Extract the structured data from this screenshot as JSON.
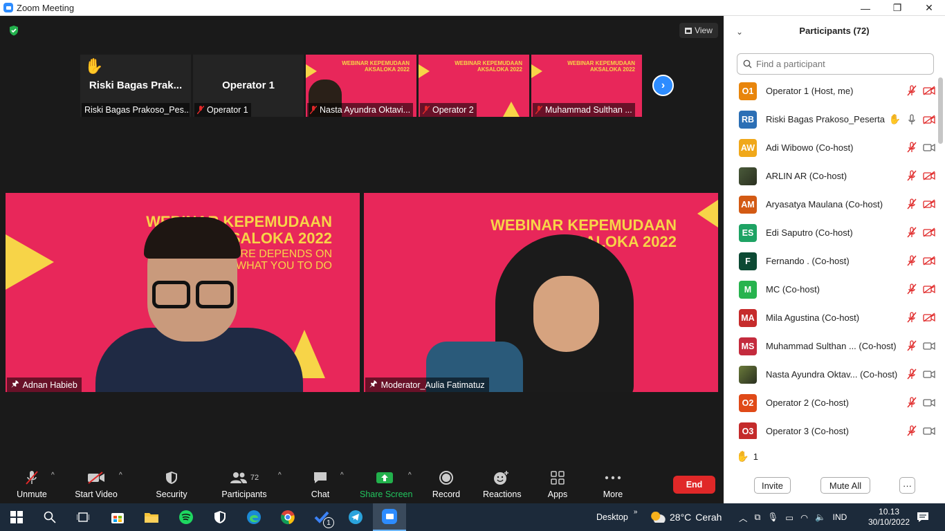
{
  "window": {
    "title": "Zoom Meeting",
    "controls": [
      "—",
      "❐",
      "✕"
    ]
  },
  "meeting": {
    "view_label": "View",
    "thumbnails": [
      {
        "kind": "name",
        "big_name": "Riski Bagas Prak...",
        "label": "Riski Bagas Prakoso_Pes...",
        "muted": false,
        "hand": true
      },
      {
        "kind": "name",
        "big_name": "Operator 1",
        "label": "Operator 1",
        "muted": true,
        "hand": false
      },
      {
        "kind": "slide",
        "slide_title": "WEBINAR KEPEMUDAAN\nAKSALOKA 2022",
        "label": "Nasta Ayundra Oktavi...",
        "muted": true
      },
      {
        "kind": "slide",
        "slide_title": "WEBINAR KEPEMUDAAN\nAKSALOKA 2022",
        "label": "Operator 2",
        "muted": true
      },
      {
        "kind": "slide",
        "slide_title": "WEBINAR KEPEMUDAAN\nAKSALOKA 2022",
        "label": "Muhammad Sulthan ...",
        "muted": true
      }
    ],
    "videos": [
      {
        "name": "Adnan Habieb",
        "title": "WEBINAR KEPEMUDAAN\nAKSALOKA 2022",
        "subtitle": "YOUR FUTURE DEPENDS ON\nWHAT YOU TO DO"
      },
      {
        "name": "Moderator_Aulia Fatimatuz",
        "title": "WEBINAR KEPEMUDAAN\nAKSALOKA 2022",
        "subtitle": ""
      }
    ]
  },
  "toolbar": {
    "unmute": "Unmute",
    "start_video": "Start Video",
    "security": "Security",
    "participants": "Participants",
    "participants_count": "72",
    "chat": "Chat",
    "share_screen": "Share Screen",
    "record": "Record",
    "reactions": "Reactions",
    "apps": "Apps",
    "more": "More",
    "end": "End"
  },
  "panel": {
    "title": "Participants (72)",
    "search_placeholder": "Find a participant",
    "participants": [
      {
        "initials": "O1",
        "color": "#e8850c",
        "name": "Operator 1 (Host, me)",
        "mic": "muted",
        "video": "off"
      },
      {
        "initials": "RB",
        "color": "#2c6fb5",
        "name": "Riski Bagas Prakoso_Peserta",
        "hand": true,
        "mic": "on",
        "video": "off"
      },
      {
        "initials": "AW",
        "color": "#f0a81a",
        "name": "Adi Wibowo (Co-host)",
        "mic": "muted",
        "video": "on"
      },
      {
        "initials": "",
        "color": "#4a5a3a",
        "name": "ARLIN AR (Co-host)",
        "mic": "muted",
        "video": "off",
        "photo": true
      },
      {
        "initials": "AM",
        "color": "#d35a14",
        "name": "Aryasatya Maulana (Co-host)",
        "mic": "muted",
        "video": "off"
      },
      {
        "initials": "ES",
        "color": "#1ea364",
        "name": "Edi Saputro (Co-host)",
        "mic": "muted",
        "video": "off"
      },
      {
        "initials": "F",
        "color": "#0d4a34",
        "name": "Fernando . (Co-host)",
        "mic": "muted",
        "video": "off"
      },
      {
        "initials": "M",
        "color": "#27b34e",
        "name": "MC (Co-host)",
        "mic": "muted",
        "video": "off"
      },
      {
        "initials": "MA",
        "color": "#c62b2b",
        "name": "Mila Agustina (Co-host)",
        "mic": "muted",
        "video": "off"
      },
      {
        "initials": "MS",
        "color": "#c42b3d",
        "name": "Muhammad Sulthan ...  (Co-host)",
        "mic": "muted",
        "video": "on"
      },
      {
        "initials": "",
        "color": "#6a7a3a",
        "name": "Nasta Ayundra Oktav...  (Co-host)",
        "mic": "muted",
        "video": "on",
        "photo": true
      },
      {
        "initials": "O2",
        "color": "#e04a18",
        "name": "Operator 2 (Co-host)",
        "mic": "muted",
        "video": "on"
      },
      {
        "initials": "O3",
        "color": "#c42b2b",
        "name": "Operator 3 (Co-host)",
        "mic": "muted",
        "video": "on"
      }
    ],
    "raised_hands": "1",
    "invite": "Invite",
    "mute_all": "Mute All",
    "more": "···"
  },
  "taskbar": {
    "desktop": "Desktop",
    "temperature": "28°C",
    "weather": "Cerah",
    "language": "IND",
    "time": "10.13",
    "date": "30/10/2022",
    "telegram_badge": "1"
  },
  "colors": {
    "accent": "#2d8cff",
    "slide_pink": "#e8275a",
    "slide_yellow": "#f7d448",
    "end_red": "#e02828",
    "share_green": "#22b14c"
  }
}
